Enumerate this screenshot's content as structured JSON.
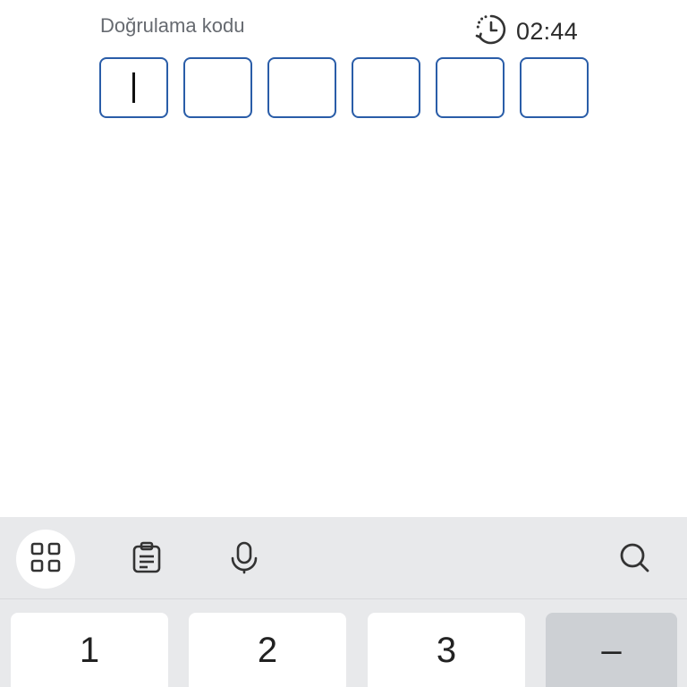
{
  "verification": {
    "label": "Doğrulama kodu",
    "timer": "02:44",
    "timer_icon": "clock-countdown-icon",
    "digits": [
      "",
      "",
      "",
      "",
      "",
      ""
    ],
    "active_index": 0,
    "accent_color": "#2a5da8"
  },
  "keyboard": {
    "toolbar": [
      {
        "name": "apps-grid-icon",
        "active": true
      },
      {
        "name": "clipboard-icon",
        "active": false
      },
      {
        "name": "microphone-icon",
        "active": false
      },
      {
        "name": "search-icon",
        "active": false
      }
    ],
    "keys": [
      "1",
      "2",
      "3",
      "–"
    ]
  }
}
